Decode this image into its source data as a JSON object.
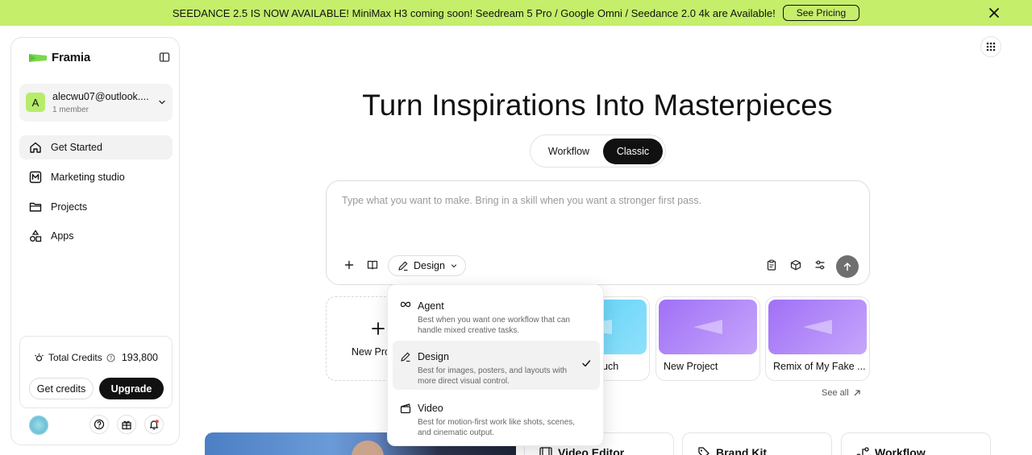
{
  "banner": {
    "text": "SEEDANCE 2.5 IS NOW AVAILABLE! MiniMax H3 coming soon! Seedream 5 Pro / Google Omni / Seedance 2.0 4k are Available!",
    "pricing_label": "See Pricing",
    "background": "#c5ee6b"
  },
  "sidebar": {
    "brand": "Framia",
    "account": {
      "initial": "A",
      "email": "alecwu07@outlook....",
      "members": "1 member"
    },
    "nav": [
      {
        "label": "Get Started",
        "icon": "home-icon",
        "active": true
      },
      {
        "label": "Marketing studio",
        "icon": "m-square-icon",
        "active": false
      },
      {
        "label": "Projects",
        "icon": "folder-icon",
        "active": false
      },
      {
        "label": "Apps",
        "icon": "apps-shapes-icon",
        "active": false
      }
    ],
    "credits": {
      "label": "Total Credits",
      "value": "193,800",
      "get_credits": "Get credits",
      "upgrade": "Upgrade"
    }
  },
  "main": {
    "headline": "Turn Inspirations Into Masterpieces",
    "modes": [
      "Workflow",
      "Classic"
    ],
    "selected_mode": "Classic",
    "prompt_placeholder": "Type what you want to make. Bring in a skill when you want a stronger first pass.",
    "mode_chip": "Design",
    "new_project_label": "New Proj",
    "projects": [
      {
        "label": "uch",
        "thumb_color": "#5fd0f7"
      },
      {
        "label": "New Project",
        "thumb_color": "#a46ef7"
      },
      {
        "label": "Remix of My Fake ...",
        "thumb_color": "#a46ef7"
      }
    ],
    "see_all": "See all",
    "tools": [
      "Video Editor",
      "Brand Kit",
      "Workflow"
    ]
  },
  "dropdown": {
    "items": [
      {
        "title": "Agent",
        "desc": "Best when you want one workflow that can handle mixed creative tasks.",
        "icon": "infinity-icon",
        "selected": false
      },
      {
        "title": "Design",
        "desc": "Best for images, posters, and layouts with more direct visual control.",
        "icon": "design-brush-icon",
        "selected": true
      },
      {
        "title": "Video",
        "desc": "Best for motion-first work like shots, scenes, and cinematic output.",
        "icon": "clapperboard-icon",
        "selected": false
      }
    ]
  }
}
